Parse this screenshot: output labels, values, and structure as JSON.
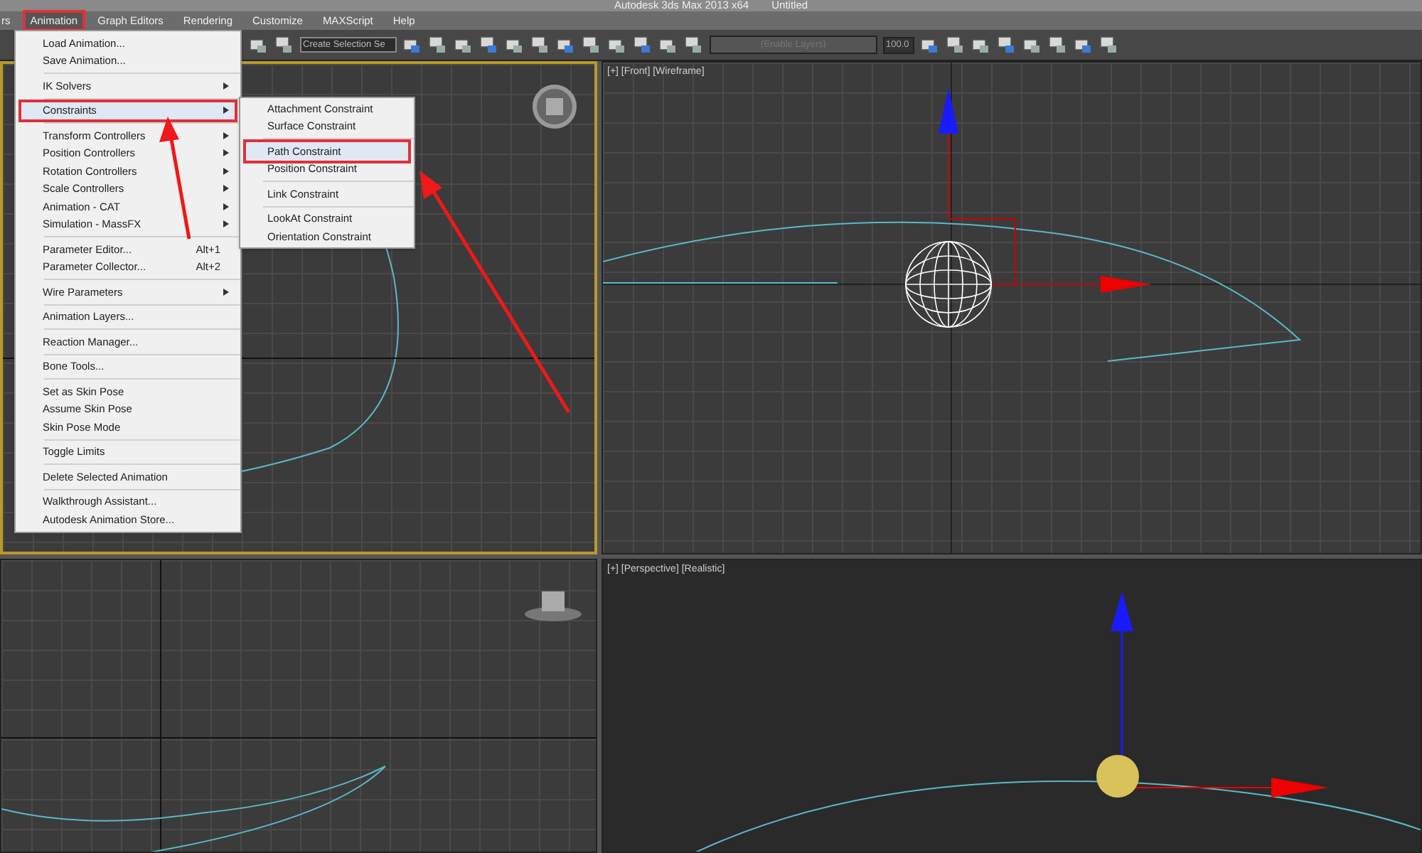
{
  "title_bar": {
    "app": "Autodesk 3ds Max  2013 x64",
    "document": "Untitled"
  },
  "menu_bar": [
    {
      "label": "rs",
      "selected": false
    },
    {
      "label": "Animation",
      "selected": true
    },
    {
      "label": "Graph Editors",
      "selected": false
    },
    {
      "label": "Rendering",
      "selected": false
    },
    {
      "label": "Customize",
      "selected": false
    },
    {
      "label": "MAXScript",
      "selected": false
    },
    {
      "label": "Help",
      "selected": false
    }
  ],
  "toolbar": {
    "selection_set": "Create Selection Se",
    "layers": "(Enable Layers)",
    "value": "100.0"
  },
  "animation_menu": [
    [
      {
        "label": "Load Animation...",
        "submenu": false,
        "selected": false
      },
      {
        "label": "Save Animation...",
        "submenu": false,
        "selected": false
      }
    ],
    [
      {
        "label": "IK Solvers",
        "submenu": true,
        "selected": false
      }
    ],
    [
      {
        "label": "Constraints",
        "submenu": true,
        "selected": true
      }
    ],
    [
      {
        "label": "Transform Controllers",
        "submenu": true,
        "selected": false
      },
      {
        "label": "Position Controllers",
        "submenu": true,
        "selected": false
      },
      {
        "label": "Rotation Controllers",
        "submenu": true,
        "selected": false
      },
      {
        "label": "Scale Controllers",
        "submenu": true,
        "selected": false
      },
      {
        "label": "Animation - CAT",
        "submenu": true,
        "selected": false
      },
      {
        "label": "Simulation - MassFX",
        "submenu": true,
        "selected": false
      }
    ],
    [
      {
        "label": "Parameter Editor...",
        "shortcut": "Alt+1",
        "submenu": false,
        "selected": false
      },
      {
        "label": "Parameter Collector...",
        "shortcut": "Alt+2",
        "submenu": false,
        "selected": false
      }
    ],
    [
      {
        "label": "Wire Parameters",
        "submenu": true,
        "selected": false
      }
    ],
    [
      {
        "label": "Animation Layers...",
        "submenu": false,
        "selected": false
      }
    ],
    [
      {
        "label": "Reaction Manager...",
        "submenu": false,
        "selected": false
      }
    ],
    [
      {
        "label": "Bone Tools...",
        "submenu": false,
        "selected": false
      }
    ],
    [
      {
        "label": "Set as Skin Pose",
        "submenu": false,
        "selected": false
      },
      {
        "label": "Assume Skin Pose",
        "submenu": false,
        "selected": false
      },
      {
        "label": "Skin Pose Mode",
        "submenu": false,
        "selected": false
      }
    ],
    [
      {
        "label": "Toggle Limits",
        "submenu": false,
        "selected": false
      }
    ],
    [
      {
        "label": "Delete Selected Animation",
        "submenu": false,
        "selected": false
      }
    ],
    [
      {
        "label": "Walkthrough Assistant...",
        "submenu": false,
        "selected": false
      },
      {
        "label": "Autodesk Animation Store...",
        "submenu": false,
        "selected": false
      }
    ]
  ],
  "constraints_submenu": [
    [
      {
        "label": "Attachment Constraint",
        "selected": false
      },
      {
        "label": "Surface Constraint",
        "selected": false
      }
    ],
    [
      {
        "label": "Path Constraint",
        "selected": true
      },
      {
        "label": "Position Constraint",
        "selected": false
      }
    ],
    [
      {
        "label": "Link Constraint",
        "selected": false
      }
    ],
    [
      {
        "label": "LookAt Constraint",
        "selected": false
      },
      {
        "label": "Orientation Constraint",
        "selected": false
      }
    ]
  ],
  "viewports": [
    {
      "kind": "top",
      "active": true
    },
    {
      "kind": "front",
      "active": false,
      "label": "[+] [Front] [Wireframe]"
    },
    {
      "kind": "left",
      "active": false
    },
    {
      "kind": "perspective",
      "active": false,
      "label": "[+] [Perspective] [Realistic]"
    }
  ]
}
